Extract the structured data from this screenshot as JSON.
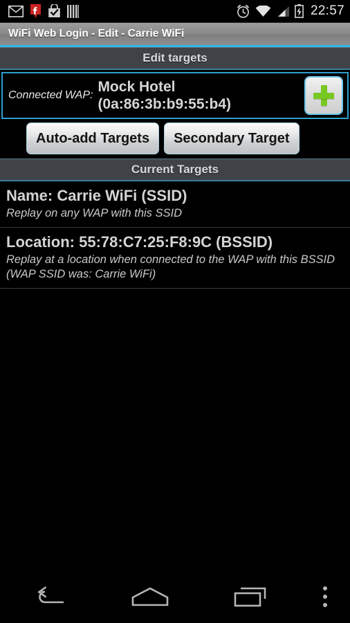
{
  "statusbar": {
    "icons_left": [
      "gmail-icon",
      "red-f-pin-icon",
      "shopping-bag-check-icon",
      "barcode-icon"
    ],
    "icons_right": [
      "alarm-clock-icon",
      "wifi-icon",
      "cellular-signal-icon",
      "battery-charging-icon"
    ],
    "time": "22:57"
  },
  "titlebar": {
    "title": "WiFi Web Login - Edit - Carrie WiFi"
  },
  "sections": {
    "edit_targets": "Edit targets",
    "current_targets": "Current Targets"
  },
  "connected_wap": {
    "label": "Connected WAP:",
    "name": "Mock Hotel",
    "bssid": "(0a:86:3b:b9:55:b4)",
    "add_button_icon": "plus-icon"
  },
  "actions": {
    "auto_add": "Auto-add Targets",
    "secondary": "Secondary Target"
  },
  "targets": [
    {
      "title": "Name: Carrie WiFi (SSID)",
      "subtitle": "Replay on any WAP with this SSID"
    },
    {
      "title": "Location: 55:78:C7:25:F8:9C (BSSID)",
      "subtitle": "Replay at a location when connected to the WAP with this BSSID (WAP SSID was: Carrie WiFi)"
    }
  ],
  "navbar": {
    "back": "back-icon",
    "home": "home-icon",
    "recents": "recents-icon",
    "overflow": "overflow-menu-icon"
  },
  "colors": {
    "accent_blue": "#33b5e5",
    "panel_border_blue": "#2d9fd0",
    "plus_green": "#78c824",
    "header_gray": "#3f4347",
    "background": "#000000"
  }
}
